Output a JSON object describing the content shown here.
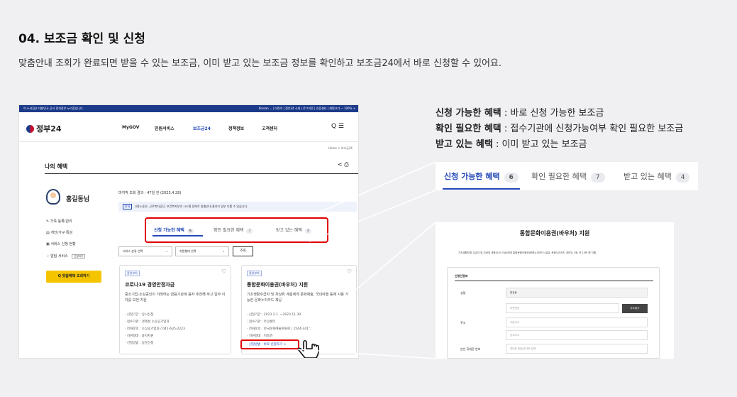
{
  "heading": {
    "title": "04. 보조금 확인 및 신청",
    "desc": "맞춤안내 조회가 완료되면 받을 수 있는 보조금, 이미 받고 있는 보조금 정보를 확인하고 보조금24에서 바로 신청할 수 있어요."
  },
  "screenshot": {
    "govbar_left": "이 누리집은 대한민국 공식 전자정부 누리집입니다.",
    "govbar_right": "Korean ⌄ | 어린이 | 정부24 소개 | 로그아웃 | 인증센터 | 화면크기 − 100% +",
    "logo": "정부24",
    "nav": [
      "MyGOV",
      "민원서비스",
      "보조금24",
      "정책정보",
      "고객센터"
    ],
    "header_icons": "Q ☰",
    "breadcrumb": "Home > 보조금24",
    "section_title": "나의 혜택",
    "share_icons": "< ⎙",
    "user_name": "홍길동님",
    "menu": [
      "가족 등록/관리",
      "개인/가구 특성",
      "서비스 신청 현황",
      "알림 서비스"
    ],
    "alarm_badge": "신청하기",
    "search_button": "Q 맞춤혜택 조회하기",
    "last_query": "마지막 조회 결과 : 47일 전 (2023.4.28)",
    "notice_badge": "안내",
    "notice": "고용노동부, 근로복지공단, 보건복지부의 시스템 장애로 맞춤안내 결과가 일부 다를 수 있습니다.",
    "tabs": [
      {
        "label": "신청 가능한 혜택",
        "count": "6"
      },
      {
        "label": "확인 필요한 혜택",
        "count": "7"
      },
      {
        "label": "받고 있는 혜택",
        "count": "4"
      }
    ],
    "filter1": "서비스 분류 선택",
    "filter2": "지원형태 선택",
    "query_button": "조회",
    "cards": [
      {
        "tag": "중앙부처",
        "title": "코로나19 경영안정자금",
        "desc": "중소기업·소상공인이 거래하는 금융기관에 융자 추천해 주고 일부 이자를 보전 지원",
        "items": [
          "신청기간 : 상시신청",
          "접수기관 : 경제성 소상공기업과",
          "전화문의 : 소상공기업과 / 041-635-2223",
          "지원형태 : 융자지원",
          "신청방법 : 방문신청"
        ]
      },
      {
        "tag": "중앙부처",
        "title": "통합문화이용권(바우처) 지원",
        "desc": "기초생활수급자 및 차상위 계층에게 문화예술, 국내여행 등에 사용 가능한 문화누리카드 제공",
        "items": [
          "신청기간 : 2023.2.1. ~2023.11.30.",
          "접수기관 : 주민센터",
          "전화문의 : 한국문화예술위원회 / 1544-3412",
          "지원형태 : 이용권",
          "신청방법 : 바로 신청하기 >"
        ]
      }
    ]
  },
  "right": {
    "line1_bold": "신청 가능한 혜택",
    "line1_rest": " : 바로 신청 가능한 보조금",
    "line2_bold": "확인 필요한 혜택",
    "line2_rest": " : 접수기관에 신청가능여부 확인 필요한 보조금",
    "line3_bold": "받고 있는 혜택",
    "line3_rest": " : 이미 받고 있는 보조금",
    "tabs": [
      {
        "label": "신청 가능한 혜택",
        "count": "6"
      },
      {
        "label": "확인 필요한 혜택",
        "count": "7"
      },
      {
        "label": "받고 있는 혜택",
        "count": "4"
      }
    ],
    "form": {
      "title": "통합문화이용권(바우처) 지원",
      "desc": "기초생활보장 수급자 및 차상위 계층(도서 이상)에게 통합문화이용권(문화누리카드) 발급, 문화누리카드 개인당 1매, 연 10만 원 지원",
      "section": "신청인정보",
      "name_label": "성명",
      "name_value": "홍길동",
      "postcode_ph": "우편번호",
      "addr_button": "주소찾기",
      "addr_label": "주소",
      "addr1_ph": "기본주소",
      "addr2_ph": "상세주소",
      "phone_label": "본인 휴대폰 번호",
      "phone_ph": "휴대폰 번호(숫자만 입력)"
    }
  },
  "colors": {
    "accent": "#2348b8",
    "highlight": "#e10000",
    "cta": "#f5c400"
  }
}
